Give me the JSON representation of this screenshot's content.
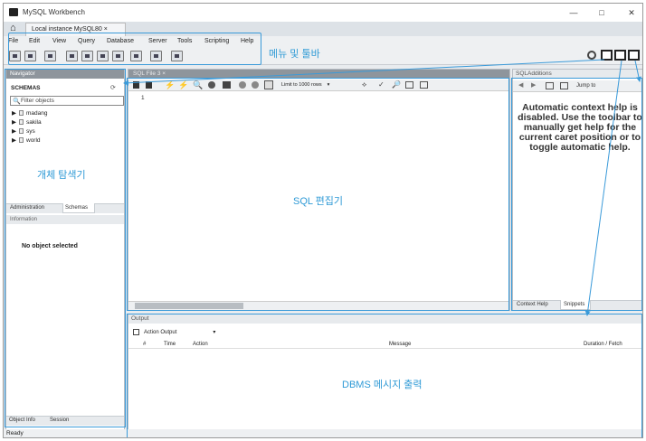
{
  "window": {
    "title": "MySQL Workbench",
    "minimize": "—",
    "maximize": "□",
    "close": "✕"
  },
  "tabs": {
    "home_icon": "home-icon",
    "connection_tab": "Local instance MySQL80  ×"
  },
  "menu": {
    "items": [
      "File",
      "Edit",
      "View",
      "Query",
      "Database",
      "Server",
      "Tools",
      "Scripting",
      "Help"
    ]
  },
  "annotations": {
    "menu_toolbar": "메뉴 및 툴바",
    "object_navigator": "개체 탐색기",
    "sql_editor": "SQL 편집기",
    "dbms_output": "DBMS 메시지 출력"
  },
  "navigator": {
    "header": "Navigator",
    "schemas_label": "SCHEMAS",
    "filter_placeholder": "Filter objects",
    "schemas": [
      "madang",
      "sakila",
      "sys",
      "world"
    ],
    "tabs": [
      "Administration",
      "Schemas"
    ],
    "information_header": "Information",
    "no_object": "No object selected",
    "bottom_tabs": [
      "Object Info",
      "Session"
    ]
  },
  "editor": {
    "tab": "SQL File 3  ×",
    "limit": "Limit to 1000 rows",
    "line_number": "1"
  },
  "sql_additions": {
    "header": "SQLAdditions",
    "jump_to": "Jump to",
    "help_text": "Automatic context help is disabled. Use the toolbar to manually get help for the current caret position or to toggle automatic help.",
    "tabs": [
      "Context Help",
      "Snippets"
    ]
  },
  "output": {
    "header": "Output",
    "selector": "Action Output",
    "columns": [
      "#",
      "Time",
      "Action",
      "Message",
      "Duration / Fetch"
    ]
  },
  "status": {
    "text": "Ready"
  },
  "colors": {
    "annotation": "#2f9ad6",
    "panel_header": "#8e959c"
  }
}
